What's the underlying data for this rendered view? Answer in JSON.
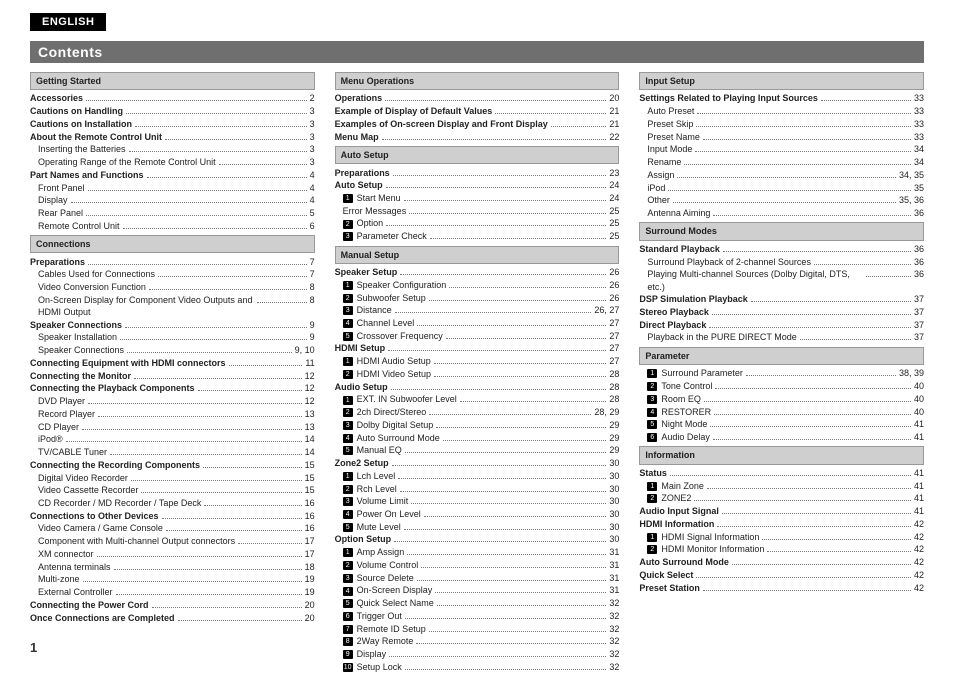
{
  "language": "ENGLISH",
  "heading": "Contents",
  "page_number": "1",
  "columns": [
    [
      {
        "type": "section",
        "label": "Getting Started"
      },
      {
        "type": "item",
        "label": "Accessories",
        "page": "2",
        "bold": true
      },
      {
        "type": "item",
        "label": "Cautions on Handling",
        "page": "3",
        "bold": true
      },
      {
        "type": "item",
        "label": "Cautions on Installation",
        "page": "3",
        "bold": true
      },
      {
        "type": "item",
        "label": "About the Remote Control Unit",
        "page": "3",
        "bold": true
      },
      {
        "type": "item",
        "label": "Inserting the Batteries",
        "page": "3",
        "sub": true
      },
      {
        "type": "item",
        "label": "Operating Range of the Remote Control Unit",
        "page": "3",
        "sub": true
      },
      {
        "type": "item",
        "label": "Part Names and Functions",
        "page": "4",
        "bold": true
      },
      {
        "type": "item",
        "label": "Front Panel",
        "page": "4",
        "sub": true
      },
      {
        "type": "item",
        "label": "Display",
        "page": "4",
        "sub": true
      },
      {
        "type": "item",
        "label": "Rear Panel",
        "page": "5",
        "sub": true
      },
      {
        "type": "item",
        "label": "Remote Control Unit",
        "page": "6",
        "sub": true
      },
      {
        "type": "section",
        "label": "Connections"
      },
      {
        "type": "item",
        "label": "Preparations",
        "page": "7",
        "bold": true
      },
      {
        "type": "item",
        "label": "Cables Used for Connections",
        "page": "7",
        "sub": true
      },
      {
        "type": "item",
        "label": "Video Conversion Function",
        "page": "8",
        "sub": true
      },
      {
        "type": "item",
        "label": "On-Screen Display for Component Video Outputs and HDMI Output",
        "page": "8",
        "sub": true
      },
      {
        "type": "item",
        "label": "Speaker Connections",
        "page": "9",
        "bold": true
      },
      {
        "type": "item",
        "label": "Speaker Installation",
        "page": "9",
        "sub": true
      },
      {
        "type": "item",
        "label": "Speaker Connections",
        "page": "9, 10",
        "sub": true
      },
      {
        "type": "item",
        "label": "Connecting Equipment with HDMI connectors",
        "page": "11",
        "bold": true
      },
      {
        "type": "item",
        "label": "Connecting the Monitor",
        "page": "12",
        "bold": true
      },
      {
        "type": "item",
        "label": "Connecting the Playback Components",
        "page": "12",
        "bold": true
      },
      {
        "type": "item",
        "label": "DVD Player",
        "page": "12",
        "sub": true
      },
      {
        "type": "item",
        "label": "Record Player",
        "page": "13",
        "sub": true
      },
      {
        "type": "item",
        "label": "CD Player",
        "page": "13",
        "sub": true
      },
      {
        "type": "item",
        "label": "iPod®",
        "page": "14",
        "sub": true
      },
      {
        "type": "item",
        "label": "TV/CABLE Tuner",
        "page": "14",
        "sub": true
      },
      {
        "type": "item",
        "label": "Connecting the Recording Components",
        "page": "15",
        "bold": true
      },
      {
        "type": "item",
        "label": "Digital Video Recorder",
        "page": "15",
        "sub": true
      },
      {
        "type": "item",
        "label": "Video Cassette Recorder",
        "page": "15",
        "sub": true
      },
      {
        "type": "item",
        "label": "CD Recorder / MD Recorder / Tape Deck",
        "page": "16",
        "sub": true
      },
      {
        "type": "item",
        "label": "Connections to Other Devices",
        "page": "16",
        "bold": true
      },
      {
        "type": "item",
        "label": "Video Camera / Game Console",
        "page": "16",
        "sub": true
      },
      {
        "type": "item",
        "label": "Component with Multi-channel Output connectors",
        "page": "17",
        "sub": true
      },
      {
        "type": "item",
        "label": "XM connector",
        "page": "17",
        "sub": true
      },
      {
        "type": "item",
        "label": "Antenna terminals",
        "page": "18",
        "sub": true
      },
      {
        "type": "item",
        "label": "Multi-zone",
        "page": "19",
        "sub": true
      },
      {
        "type": "item",
        "label": "External Controller",
        "page": "19",
        "sub": true
      },
      {
        "type": "item",
        "label": "Connecting the Power Cord",
        "page": "20",
        "bold": true
      },
      {
        "type": "item",
        "label": "Once Connections are Completed",
        "page": "20",
        "bold": true
      }
    ],
    [
      {
        "type": "section",
        "label": "Menu Operations"
      },
      {
        "type": "item",
        "label": "Operations",
        "page": "20",
        "bold": true
      },
      {
        "type": "item",
        "label": "Example of Display of Default Values",
        "page": "21",
        "bold": true
      },
      {
        "type": "item",
        "label": "Examples of On-screen Display and Front Display",
        "page": "21",
        "bold": true
      },
      {
        "type": "item",
        "label": "Menu Map",
        "page": "22",
        "bold": true
      },
      {
        "type": "section",
        "label": "Auto Setup"
      },
      {
        "type": "item",
        "label": "Preparations",
        "page": "23",
        "bold": true
      },
      {
        "type": "item",
        "label": "Auto Setup",
        "page": "24",
        "bold": true
      },
      {
        "type": "item",
        "label": "Start Menu",
        "page": "24",
        "sub": true,
        "num": "1"
      },
      {
        "type": "item",
        "label": "Error Messages",
        "page": "25",
        "sub": true,
        "sub2": true
      },
      {
        "type": "item",
        "label": "Option",
        "page": "25",
        "sub": true,
        "num": "2"
      },
      {
        "type": "item",
        "label": "Parameter Check",
        "page": "25",
        "sub": true,
        "num": "3"
      },
      {
        "type": "section",
        "label": "Manual Setup"
      },
      {
        "type": "item",
        "label": "Speaker Setup",
        "page": "26",
        "bold": true
      },
      {
        "type": "item",
        "label": "Speaker Configuration",
        "page": "26",
        "sub": true,
        "num": "1"
      },
      {
        "type": "item",
        "label": "Subwoofer Setup",
        "page": "26",
        "sub": true,
        "num": "2"
      },
      {
        "type": "item",
        "label": "Distance",
        "page": "26, 27",
        "sub": true,
        "num": "3"
      },
      {
        "type": "item",
        "label": "Channel Level",
        "page": "27",
        "sub": true,
        "num": "4"
      },
      {
        "type": "item",
        "label": "Crossover Frequency",
        "page": "27",
        "sub": true,
        "num": "5"
      },
      {
        "type": "item",
        "label": "HDMI Setup",
        "page": "27",
        "bold": true
      },
      {
        "type": "item",
        "label": "HDMI Audio Setup",
        "page": "27",
        "sub": true,
        "num": "1"
      },
      {
        "type": "item",
        "label": "HDMI Video Setup",
        "page": "28",
        "sub": true,
        "num": "2"
      },
      {
        "type": "item",
        "label": "Audio Setup",
        "page": "28",
        "bold": true
      },
      {
        "type": "item",
        "label": "EXT. IN Subwoofer Level",
        "page": "28",
        "sub": true,
        "num": "1"
      },
      {
        "type": "item",
        "label": "2ch Direct/Stereo",
        "page": "28, 29",
        "sub": true,
        "num": "2"
      },
      {
        "type": "item",
        "label": "Dolby Digital Setup",
        "page": "29",
        "sub": true,
        "num": "3"
      },
      {
        "type": "item",
        "label": "Auto Surround Mode",
        "page": "29",
        "sub": true,
        "num": "4"
      },
      {
        "type": "item",
        "label": "Manual EQ",
        "page": "29",
        "sub": true,
        "num": "5"
      },
      {
        "type": "item",
        "label": "Zone2 Setup",
        "page": "30",
        "bold": true
      },
      {
        "type": "item",
        "label": "Lch Level",
        "page": "30",
        "sub": true,
        "num": "1"
      },
      {
        "type": "item",
        "label": "Rch Level",
        "page": "30",
        "sub": true,
        "num": "2"
      },
      {
        "type": "item",
        "label": "Volume Limit",
        "page": "30",
        "sub": true,
        "num": "3"
      },
      {
        "type": "item",
        "label": "Power On Level",
        "page": "30",
        "sub": true,
        "num": "4"
      },
      {
        "type": "item",
        "label": "Mute Level",
        "page": "30",
        "sub": true,
        "num": "5"
      },
      {
        "type": "item",
        "label": "Option Setup",
        "page": "30",
        "bold": true
      },
      {
        "type": "item",
        "label": "Amp Assign",
        "page": "31",
        "sub": true,
        "num": "1"
      },
      {
        "type": "item",
        "label": "Volume Control",
        "page": "31",
        "sub": true,
        "num": "2"
      },
      {
        "type": "item",
        "label": "Source Delete",
        "page": "31",
        "sub": true,
        "num": "3"
      },
      {
        "type": "item",
        "label": "On-Screen Display",
        "page": "31",
        "sub": true,
        "num": "4"
      },
      {
        "type": "item",
        "label": "Quick Select Name",
        "page": "32",
        "sub": true,
        "num": "5"
      },
      {
        "type": "item",
        "label": "Trigger Out",
        "page": "32",
        "sub": true,
        "num": "6"
      },
      {
        "type": "item",
        "label": "Remote ID Setup",
        "page": "32",
        "sub": true,
        "num": "7"
      },
      {
        "type": "item",
        "label": "2Way Remote",
        "page": "32",
        "sub": true,
        "num": "8"
      },
      {
        "type": "item",
        "label": "Display",
        "page": "32",
        "sub": true,
        "num": "9"
      },
      {
        "type": "item",
        "label": "Setup Lock",
        "page": "32",
        "sub": true,
        "num": "10"
      }
    ],
    [
      {
        "type": "section",
        "label": "Input Setup"
      },
      {
        "type": "item",
        "label": "Settings Related to Playing Input Sources",
        "page": "33",
        "bold": true
      },
      {
        "type": "item",
        "label": "Auto Preset",
        "page": "33",
        "sub": true
      },
      {
        "type": "item",
        "label": "Preset Skip",
        "page": "33",
        "sub": true
      },
      {
        "type": "item",
        "label": "Preset Name",
        "page": "33",
        "sub": true
      },
      {
        "type": "item",
        "label": "Input Mode",
        "page": "34",
        "sub": true
      },
      {
        "type": "item",
        "label": "Rename",
        "page": "34",
        "sub": true
      },
      {
        "type": "item",
        "label": "Assign",
        "page": "34, 35",
        "sub": true
      },
      {
        "type": "item",
        "label": "iPod",
        "page": "35",
        "sub": true
      },
      {
        "type": "item",
        "label": "Other",
        "page": "35, 36",
        "sub": true
      },
      {
        "type": "item",
        "label": "Antenna Aiming",
        "page": "36",
        "sub": true
      },
      {
        "type": "section",
        "label": "Surround Modes"
      },
      {
        "type": "item",
        "label": "Standard Playback",
        "page": "36",
        "bold": true
      },
      {
        "type": "item",
        "label": "Surround Playback of 2-channel Sources",
        "page": "36",
        "sub": true
      },
      {
        "type": "item",
        "label": "Playing Multi-channel Sources (Dolby Digital, DTS, etc.)",
        "page": "36",
        "sub": true
      },
      {
        "type": "item",
        "label": "DSP Simulation Playback",
        "page": "37",
        "bold": true
      },
      {
        "type": "item",
        "label": "Stereo Playback",
        "page": "37",
        "bold": true
      },
      {
        "type": "item",
        "label": "Direct Playback",
        "page": "37",
        "bold": true
      },
      {
        "type": "item",
        "label": "Playback in the PURE DIRECT Mode",
        "page": "37",
        "sub": true
      },
      {
        "type": "section",
        "label": "Parameter"
      },
      {
        "type": "item",
        "label": "Surround Parameter",
        "page": "38, 39",
        "sub": true,
        "num": "1"
      },
      {
        "type": "item",
        "label": "Tone Control",
        "page": "40",
        "sub": true,
        "num": "2"
      },
      {
        "type": "item",
        "label": "Room EQ",
        "page": "40",
        "sub": true,
        "num": "3"
      },
      {
        "type": "item",
        "label": "RESTORER",
        "page": "40",
        "sub": true,
        "num": "4"
      },
      {
        "type": "item",
        "label": "Night Mode",
        "page": "41",
        "sub": true,
        "num": "5"
      },
      {
        "type": "item",
        "label": "Audio Delay",
        "page": "41",
        "sub": true,
        "num": "6"
      },
      {
        "type": "section",
        "label": "Information"
      },
      {
        "type": "item",
        "label": "Status",
        "page": "41",
        "bold": true
      },
      {
        "type": "item",
        "label": "Main Zone",
        "page": "41",
        "sub": true,
        "num": "1"
      },
      {
        "type": "item",
        "label": "ZONE2",
        "page": "41",
        "sub": true,
        "num": "2"
      },
      {
        "type": "item",
        "label": "Audio Input Signal",
        "page": "41",
        "bold": true
      },
      {
        "type": "item",
        "label": "HDMI Information",
        "page": "42",
        "bold": true
      },
      {
        "type": "item",
        "label": "HDMI Signal Information",
        "page": "42",
        "sub": true,
        "num": "1"
      },
      {
        "type": "item",
        "label": "HDMI Monitor Information",
        "page": "42",
        "sub": true,
        "num": "2"
      },
      {
        "type": "item",
        "label": "Auto Surround Mode",
        "page": "42",
        "bold": true
      },
      {
        "type": "item",
        "label": "Quick Select",
        "page": "42",
        "bold": true
      },
      {
        "type": "item",
        "label": "Preset Station",
        "page": "42",
        "bold": true
      }
    ]
  ]
}
